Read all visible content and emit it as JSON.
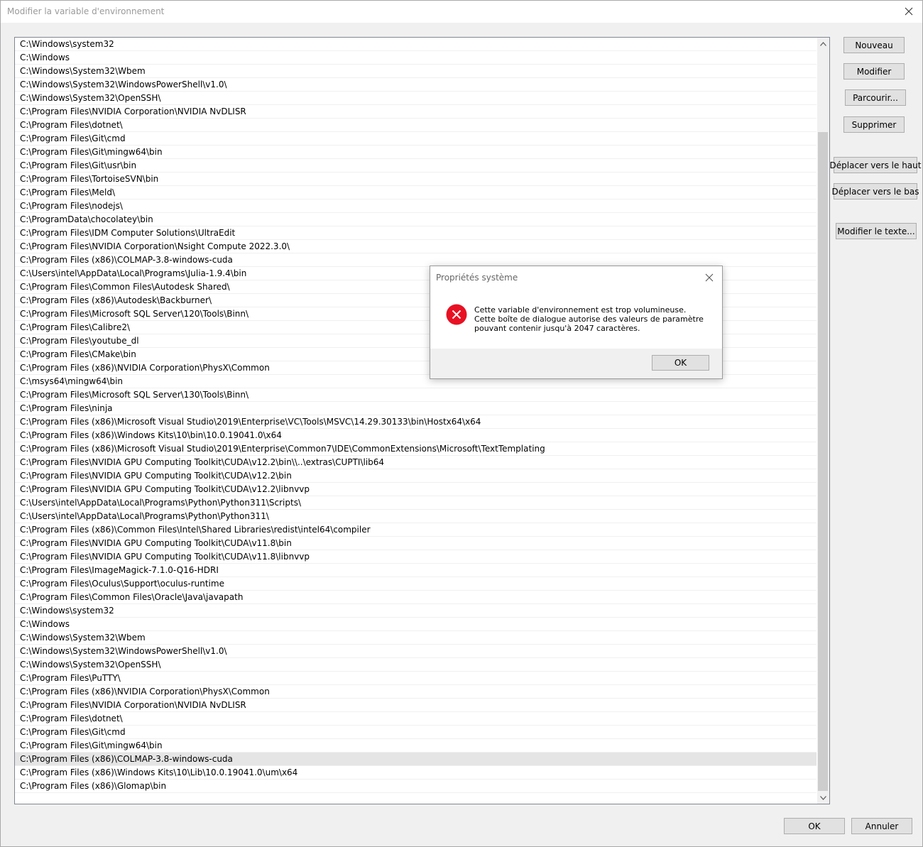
{
  "window": {
    "title": "Modifier la variable d'environnement"
  },
  "list": {
    "items": [
      "C:\\Windows\\system32",
      "C:\\Windows",
      "C:\\Windows\\System32\\Wbem",
      "C:\\Windows\\System32\\WindowsPowerShell\\v1.0\\",
      "C:\\Windows\\System32\\OpenSSH\\",
      "C:\\Program Files\\NVIDIA Corporation\\NVIDIA NvDLISR",
      "C:\\Program Files\\dotnet\\",
      "C:\\Program Files\\Git\\cmd",
      "C:\\Program Files\\Git\\mingw64\\bin",
      "C:\\Program Files\\Git\\usr\\bin",
      "C:\\Program Files\\TortoiseSVN\\bin",
      "C:\\Program Files\\Meld\\",
      "C:\\Program Files\\nodejs\\",
      "C:\\ProgramData\\chocolatey\\bin",
      "C:\\Program Files\\IDM Computer Solutions\\UltraEdit",
      "C:\\Program Files\\NVIDIA Corporation\\Nsight Compute 2022.3.0\\",
      "C:\\Program Files (x86)\\COLMAP-3.8-windows-cuda",
      "C:\\Users\\intel\\AppData\\Local\\Programs\\Julia-1.9.4\\bin",
      "C:\\Program Files\\Common Files\\Autodesk Shared\\",
      "C:\\Program Files (x86)\\Autodesk\\Backburner\\",
      "C:\\Program Files\\Microsoft SQL Server\\120\\Tools\\Binn\\",
      "C:\\Program Files\\Calibre2\\",
      "C:\\Program Files\\youtube_dl",
      "C:\\Program Files\\CMake\\bin",
      "C:\\Program Files (x86)\\NVIDIA Corporation\\PhysX\\Common",
      "C:\\msys64\\mingw64\\bin",
      "C:\\Program Files\\Microsoft SQL Server\\130\\Tools\\Binn\\",
      "C:\\Program Files\\ninja",
      "C:\\Program Files (x86)\\Microsoft Visual Studio\\2019\\Enterprise\\VC\\Tools\\MSVC\\14.29.30133\\bin\\Hostx64\\x64",
      "C:\\Program Files (x86)\\Windows Kits\\10\\bin\\10.0.19041.0\\x64",
      "C:\\Program Files (x86)\\Microsoft Visual Studio\\2019\\Enterprise\\Common7\\IDE\\CommonExtensions\\Microsoft\\TextTemplating",
      "C:\\Program Files\\NVIDIA GPU Computing Toolkit\\CUDA\\v12.2\\bin\\\\..\\extras\\CUPTI\\lib64",
      "C:\\Program Files\\NVIDIA GPU Computing Toolkit\\CUDA\\v12.2\\bin",
      "C:\\Program Files\\NVIDIA GPU Computing Toolkit\\CUDA\\v12.2\\libnvvp",
      "C:\\Users\\intel\\AppData\\Local\\Programs\\Python\\Python311\\Scripts\\",
      "C:\\Users\\intel\\AppData\\Local\\Programs\\Python\\Python311\\",
      "C:\\Program Files (x86)\\Common Files\\Intel\\Shared Libraries\\redist\\intel64\\compiler",
      "C:\\Program Files\\NVIDIA GPU Computing Toolkit\\CUDA\\v11.8\\bin",
      "C:\\Program Files\\NVIDIA GPU Computing Toolkit\\CUDA\\v11.8\\libnvvp",
      "C:\\Program Files\\ImageMagick-7.1.0-Q16-HDRI",
      "C:\\Program Files\\Oculus\\Support\\oculus-runtime",
      "C:\\Program Files\\Common Files\\Oracle\\Java\\javapath",
      "C:\\Windows\\system32",
      "C:\\Windows",
      "C:\\Windows\\System32\\Wbem",
      "C:\\Windows\\System32\\WindowsPowerShell\\v1.0\\",
      "C:\\Windows\\System32\\OpenSSH\\",
      "C:\\Program Files\\PuTTY\\",
      "C:\\Program Files (x86)\\NVIDIA Corporation\\PhysX\\Common",
      "C:\\Program Files\\NVIDIA Corporation\\NVIDIA NvDLISR",
      "C:\\Program Files\\dotnet\\",
      "C:\\Program Files\\Git\\cmd",
      "C:\\Program Files\\Git\\mingw64\\bin",
      "C:\\Program Files (x86)\\COLMAP-3.8-windows-cuda",
      "C:\\Program Files (x86)\\Windows Kits\\10\\Lib\\10.0.19041.0\\um\\x64",
      "C:\\Program Files (x86)\\Glomap\\bin"
    ],
    "selected_index": 53
  },
  "buttons": {
    "new": "Nouveau",
    "edit": "Modifier",
    "browse": "Parcourir...",
    "delete": "Supprimer",
    "move_up": "Déplacer vers le haut",
    "move_down": "Déplacer vers le bas",
    "edit_text": "Modifier le texte...",
    "ok": "OK",
    "cancel": "Annuler"
  },
  "dialog": {
    "title": "Propriétés système",
    "message": "Cette variable d'environnement est trop volumineuse. Cette boîte de dialogue autorise des valeurs de paramètre pouvant contenir jusqu'à 2047 caractères.",
    "ok": "OK",
    "icon": "error-icon"
  },
  "colors": {
    "error_red": "#e81123",
    "button_bg": "#e1e1e1",
    "selection_bg": "#e5e5e5"
  }
}
